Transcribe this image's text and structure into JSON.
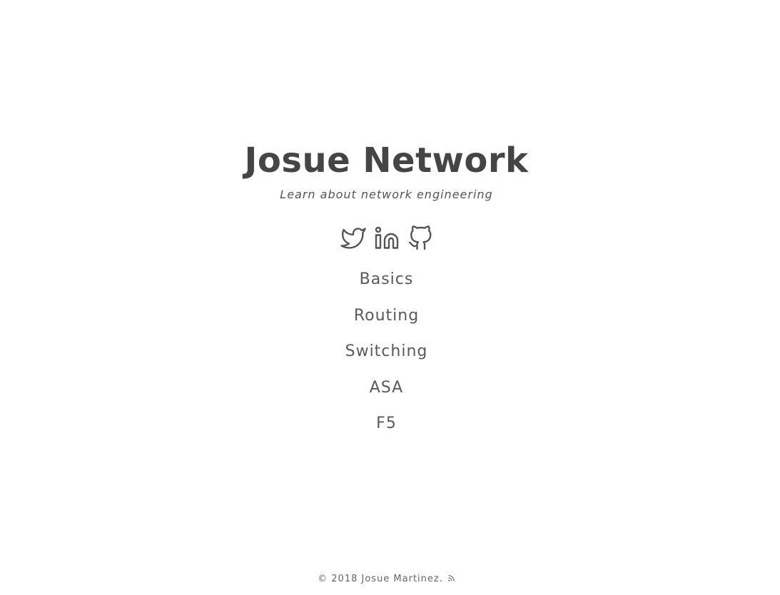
{
  "header": {
    "title": "Josue Network",
    "tagline": "Learn about network engineering"
  },
  "social": [
    {
      "icon": "twitter-icon"
    },
    {
      "icon": "linkedin-icon"
    },
    {
      "icon": "github-icon"
    }
  ],
  "nav": {
    "items": [
      "Basics",
      "Routing",
      "Switching",
      "ASA",
      "F5"
    ]
  },
  "footer": {
    "copyright": "© 2018 Josue Martinez.",
    "rss_icon": "rss-icon"
  },
  "colors": {
    "text": "#4a4a4a",
    "background": "#ffffff"
  }
}
